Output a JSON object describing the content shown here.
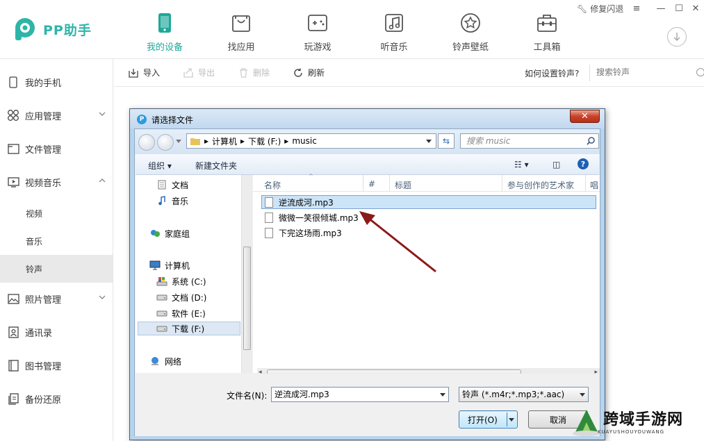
{
  "app": {
    "name": "PP助手",
    "repair_label": "修复闪退",
    "accent": "#1fa89a"
  },
  "nav": [
    {
      "label": "我的设备",
      "icon": "phone-icon"
    },
    {
      "label": "找应用",
      "icon": "bag-icon"
    },
    {
      "label": "玩游戏",
      "icon": "gamepad-icon"
    },
    {
      "label": "听音乐",
      "icon": "music-note-icon"
    },
    {
      "label": "铃声壁纸",
      "icon": "star-icon"
    },
    {
      "label": "工具箱",
      "icon": "toolbox-icon"
    }
  ],
  "sidebar": {
    "items": [
      {
        "label": "我的手机"
      },
      {
        "label": "应用管理"
      },
      {
        "label": "文件管理"
      },
      {
        "label": "视频音乐"
      },
      {
        "label": "照片管理"
      },
      {
        "label": "通讯录"
      },
      {
        "label": "图书管理"
      },
      {
        "label": "备份还原"
      }
    ],
    "sub_items": [
      {
        "label": "视频"
      },
      {
        "label": "音乐"
      },
      {
        "label": "铃声"
      }
    ]
  },
  "toolbar": {
    "import": "导入",
    "export": "导出",
    "delete": "删除",
    "refresh": "刷新",
    "howto": "如何设置铃声?",
    "search_placeholder": "搜索铃声"
  },
  "dialog": {
    "title": "请选择文件",
    "breadcrumb": [
      "计算机",
      "下载 (F:)",
      "music"
    ],
    "search_placeholder": "搜索 music",
    "organize": "组织",
    "new_folder": "新建文件夹",
    "tree": [
      {
        "label": "文档"
      },
      {
        "label": "音乐"
      },
      {
        "label": "家庭组"
      },
      {
        "label": "计算机"
      },
      {
        "label": "系统 (C:)"
      },
      {
        "label": "文档 (D:)"
      },
      {
        "label": "软件 (E:)"
      },
      {
        "label": "下载 (F:)"
      },
      {
        "label": "网络"
      }
    ],
    "columns": [
      "名称",
      "#",
      "标题",
      "参与创作的艺术家",
      "唱"
    ],
    "files": [
      {
        "name": "逆流成河.mp3"
      },
      {
        "name": "微微一笑很倾城.mp3"
      },
      {
        "name": "下完这场雨.mp3"
      }
    ],
    "filename_label": "文件名(N):",
    "filename_value": "逆流成河.mp3",
    "filetype": "铃声 (*.m4r;*.mp3;*.aac)",
    "open_label": "打开(O)",
    "cancel_label": "取消"
  },
  "watermark": {
    "title": "跨域手游网",
    "sub": "KUAYUSHOUYOUWANG"
  }
}
